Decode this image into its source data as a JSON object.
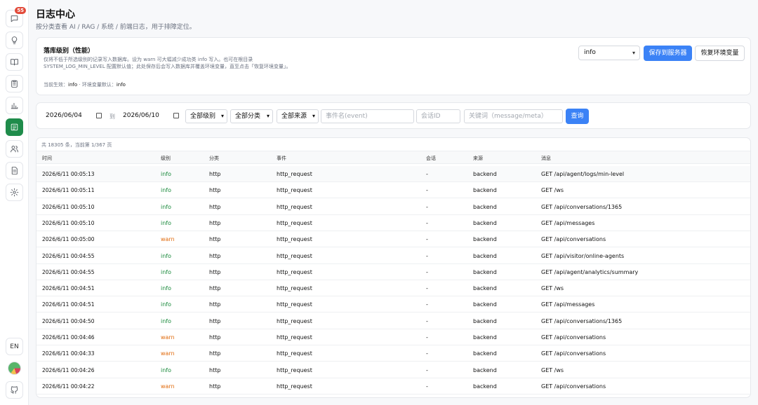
{
  "sidebar": {
    "chat_badge": "55",
    "lang": "EN"
  },
  "page": {
    "title": "日志中心",
    "subtitle": "按分类查看 AI / RAG / 系统 / 前端日志，用于排障定位。"
  },
  "level_card": {
    "title": "落库级别（性能）",
    "description": "仅将不低于所选级别的记录写入数据库。设为 warn 可大幅减少成功类 info 写入。也可在根目录 SYSTEM_LOG_MIN_LEVEL 配置默认值；此处保存后会写入数据库并覆盖环境变量，直至点击「恢复环境变量」。",
    "current_label": "当前生效：",
    "current_value": "info",
    "env_label": " · 环境变量默认：",
    "env_value": "info",
    "select_value": "info",
    "save_label": "保存到服务器",
    "reset_label": "恢复环境变量"
  },
  "filters": {
    "date_from": "2026/06/04",
    "to_label": "到",
    "date_to": "2026/06/10",
    "level_value": "全部级别",
    "category_value": "全部分类",
    "source_value": "全部来源",
    "event_placeholder": "事件名(event)",
    "session_placeholder": "会话ID",
    "keyword_placeholder": "关键词（message/meta）",
    "query_label": "查询"
  },
  "table": {
    "summary": "共 18305 条，当前第 1/367 页",
    "headers": {
      "time": "时间",
      "level": "级别",
      "category": "分类",
      "event": "事件",
      "session": "会话",
      "source": "来源",
      "message": "消息"
    },
    "rows": [
      {
        "time": "2026/6/11 00:05:13",
        "level": "info",
        "category": "http",
        "event": "http_request",
        "session": "-",
        "source": "backend",
        "message": "GET /api/agent/logs/min-level"
      },
      {
        "time": "2026/6/11 00:05:11",
        "level": "info",
        "category": "http",
        "event": "http_request",
        "session": "-",
        "source": "backend",
        "message": "GET /ws"
      },
      {
        "time": "2026/6/11 00:05:10",
        "level": "info",
        "category": "http",
        "event": "http_request",
        "session": "-",
        "source": "backend",
        "message": "GET /api/conversations/1365"
      },
      {
        "time": "2026/6/11 00:05:10",
        "level": "info",
        "category": "http",
        "event": "http_request",
        "session": "-",
        "source": "backend",
        "message": "GET /api/messages"
      },
      {
        "time": "2026/6/11 00:05:00",
        "level": "warn",
        "category": "http",
        "event": "http_request",
        "session": "-",
        "source": "backend",
        "message": "GET /api/conversations"
      },
      {
        "time": "2026/6/11 00:04:55",
        "level": "info",
        "category": "http",
        "event": "http_request",
        "session": "-",
        "source": "backend",
        "message": "GET /api/visitor/online-agents"
      },
      {
        "time": "2026/6/11 00:04:55",
        "level": "info",
        "category": "http",
        "event": "http_request",
        "session": "-",
        "source": "backend",
        "message": "GET /api/agent/analytics/summary"
      },
      {
        "time": "2026/6/11 00:04:51",
        "level": "info",
        "category": "http",
        "event": "http_request",
        "session": "-",
        "source": "backend",
        "message": "GET /ws"
      },
      {
        "time": "2026/6/11 00:04:51",
        "level": "info",
        "category": "http",
        "event": "http_request",
        "session": "-",
        "source": "backend",
        "message": "GET /api/messages"
      },
      {
        "time": "2026/6/11 00:04:50",
        "level": "info",
        "category": "http",
        "event": "http_request",
        "session": "-",
        "source": "backend",
        "message": "GET /api/conversations/1365"
      },
      {
        "time": "2026/6/11 00:04:46",
        "level": "warn",
        "category": "http",
        "event": "http_request",
        "session": "-",
        "source": "backend",
        "message": "GET /api/conversations"
      },
      {
        "time": "2026/6/11 00:04:33",
        "level": "warn",
        "category": "http",
        "event": "http_request",
        "session": "-",
        "source": "backend",
        "message": "GET /api/conversations"
      },
      {
        "time": "2026/6/11 00:04:26",
        "level": "info",
        "category": "http",
        "event": "http_request",
        "session": "-",
        "source": "backend",
        "message": "GET /ws"
      },
      {
        "time": "2026/6/11 00:04:22",
        "level": "warn",
        "category": "http",
        "event": "http_request",
        "session": "-",
        "source": "backend",
        "message": "GET /api/conversations"
      }
    ]
  },
  "colors": {
    "accent": "#3b82f6",
    "active_nav": "#1f8c4b",
    "level_info": "#1a8a3c",
    "level_warn": "#e06a0c"
  }
}
